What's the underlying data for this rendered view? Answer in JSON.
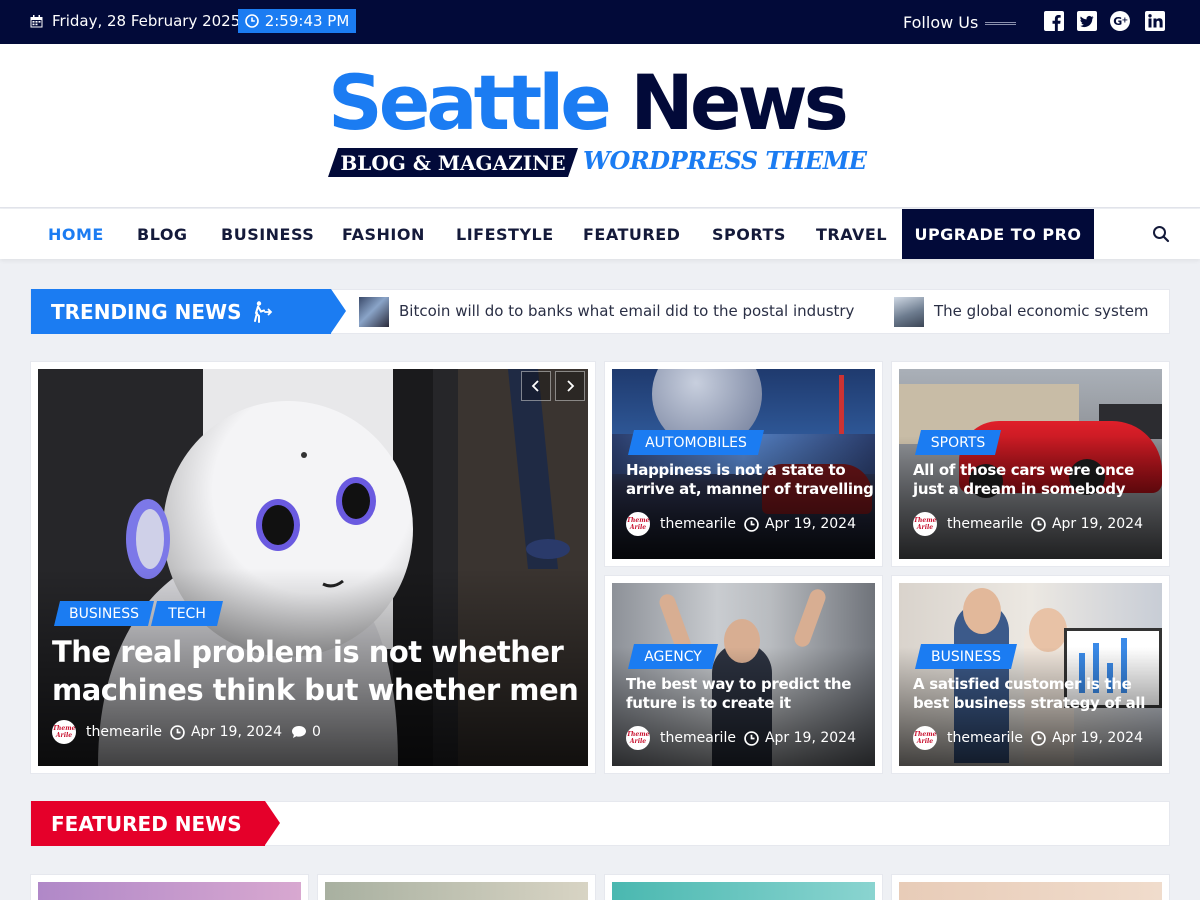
{
  "topbar": {
    "date": "Friday, 28 February 2025",
    "time": "2:59:43 PM",
    "follow_label": "Follow Us",
    "social_icons": [
      "facebook-icon",
      "twitter-icon",
      "google-plus-icon",
      "linkedin-icon"
    ]
  },
  "logo": {
    "word1": "Seattle",
    "word2": "News",
    "tag_primary": "BLOG & MAGAZINE",
    "tag_secondary": "WORDPRESS THEME"
  },
  "nav": {
    "items": [
      "HOME",
      "BLOG",
      "BUSINESS",
      "FASHION",
      "LIFESTYLE",
      "FEATURED",
      "SPORTS",
      "TRAVEL"
    ],
    "active": "HOME",
    "pro_label": "UPGRADE TO PRO"
  },
  "trending": {
    "label": "TRENDING NEWS",
    "items": [
      "Bitcoin will do to banks what email did to the postal industry",
      "The global economic system"
    ]
  },
  "main_post": {
    "categories": [
      "BUSINESS",
      "TECH"
    ],
    "title_line1": "The real problem is not whether",
    "title_line2": "machines think but whether men",
    "author": "themearile",
    "date": "Apr 19, 2024",
    "comments": "0"
  },
  "avatar_text": {
    "line1": "Theme",
    "line2": "Arile"
  },
  "side_posts": [
    {
      "category": "AUTOMOBILES",
      "line1": "Happiness is not a state to",
      "line2": "arrive at, manner of travelling",
      "author": "themearile",
      "date": "Apr 19, 2024"
    },
    {
      "category": "SPORTS",
      "line1": "All of those cars were once",
      "line2": "just a dream in somebody",
      "author": "themearile",
      "date": "Apr 19, 2024"
    },
    {
      "category": "AGENCY",
      "line1": "The best way to predict the",
      "line2": "future is to create it",
      "author": "themearile",
      "date": "Apr 19, 2024"
    },
    {
      "category": "BUSINESS",
      "line1": "A satisfied customer is the",
      "line2": "best business strategy of all",
      "author": "themearile",
      "date": "Apr 19, 2024"
    }
  ],
  "featured": {
    "label": "FEATURED NEWS"
  },
  "colors": {
    "navy": "#020a39",
    "accent": "#1b7cf2",
    "red": "#e5002a"
  }
}
